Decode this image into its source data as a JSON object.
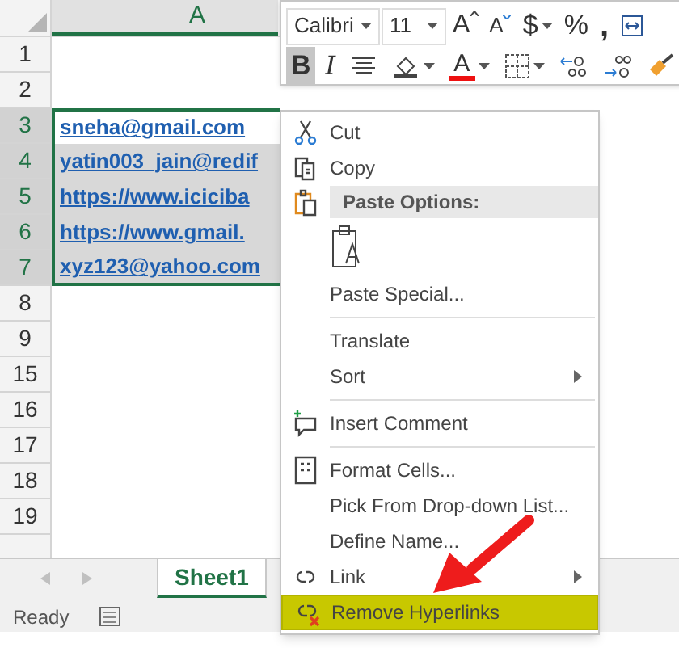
{
  "sheet": {
    "column_header": "A",
    "rows": [
      {
        "label": "1",
        "value": "",
        "selected": false
      },
      {
        "label": "2",
        "value": "",
        "selected": false
      },
      {
        "label": "3",
        "value": "sneha@gmail.com",
        "selected": true
      },
      {
        "label": "4",
        "value": "yatin003_jain@redif",
        "selected": true
      },
      {
        "label": "5",
        "value": "https://www.iciciba",
        "selected": true
      },
      {
        "label": "6",
        "value": "https://www.gmail.",
        "selected": true
      },
      {
        "label": "7",
        "value": "xyz123@yahoo.com",
        "selected": true
      },
      {
        "label": "8",
        "value": "",
        "selected": false
      },
      {
        "label": "9",
        "value": "",
        "selected": false
      },
      {
        "label": "15",
        "value": "",
        "selected": false
      },
      {
        "label": "16",
        "value": "",
        "selected": false
      },
      {
        "label": "17",
        "value": "",
        "selected": false
      },
      {
        "label": "18",
        "value": "",
        "selected": false
      },
      {
        "label": "19",
        "value": "",
        "selected": false
      }
    ]
  },
  "mini_toolbar": {
    "font": "Calibri",
    "size": "11",
    "row_1": [
      {
        "kind": "grow",
        "label": "A"
      },
      {
        "kind": "shrink",
        "label": "A"
      },
      {
        "kind": "text",
        "label": "$",
        "dropdown": true
      },
      {
        "kind": "text",
        "label": "%"
      },
      {
        "kind": "comma",
        "label": ","
      },
      {
        "kind": "wrap"
      }
    ],
    "row_2": [
      {
        "kind": "text",
        "label": "B",
        "selected": true
      },
      {
        "kind": "italic",
        "label": "I",
        "selected": false
      },
      {
        "kind": "align"
      },
      {
        "kind": "fill",
        "dropdown": true
      },
      {
        "kind": "fontcolor",
        "label": "A",
        "dropdown": true
      },
      {
        "kind": "borders",
        "dropdown": true
      },
      {
        "kind": "decdec"
      },
      {
        "kind": "incdec"
      },
      {
        "kind": "painter"
      }
    ]
  },
  "context_menu": [
    {
      "kind": "cut",
      "label": "Cut"
    },
    {
      "kind": "copy",
      "label": "Copy"
    },
    {
      "kind": "header",
      "label": "Paste Options:"
    },
    {
      "kind": "paste_icons"
    },
    {
      "kind": "plain",
      "label": "Paste Special..."
    },
    {
      "kind": "separator"
    },
    {
      "kind": "plain",
      "label": "Translate"
    },
    {
      "kind": "plain",
      "label": "Sort",
      "submenu": true
    },
    {
      "kind": "separator"
    },
    {
      "kind": "comment",
      "label": "Insert Comment"
    },
    {
      "kind": "separator"
    },
    {
      "kind": "format",
      "label": "Format Cells..."
    },
    {
      "kind": "plain",
      "label": "Pick From Drop-down List..."
    },
    {
      "kind": "plain",
      "label": "Define Name..."
    },
    {
      "kind": "link",
      "label": "Link",
      "submenu": true
    },
    {
      "kind": "unlink",
      "label": "Remove Hyperlinks",
      "highlighted": true
    }
  ],
  "sheet_tabs": [
    {
      "label": "Sheet1",
      "selected": true
    }
  ],
  "status_bar": {
    "text": "Ready"
  }
}
